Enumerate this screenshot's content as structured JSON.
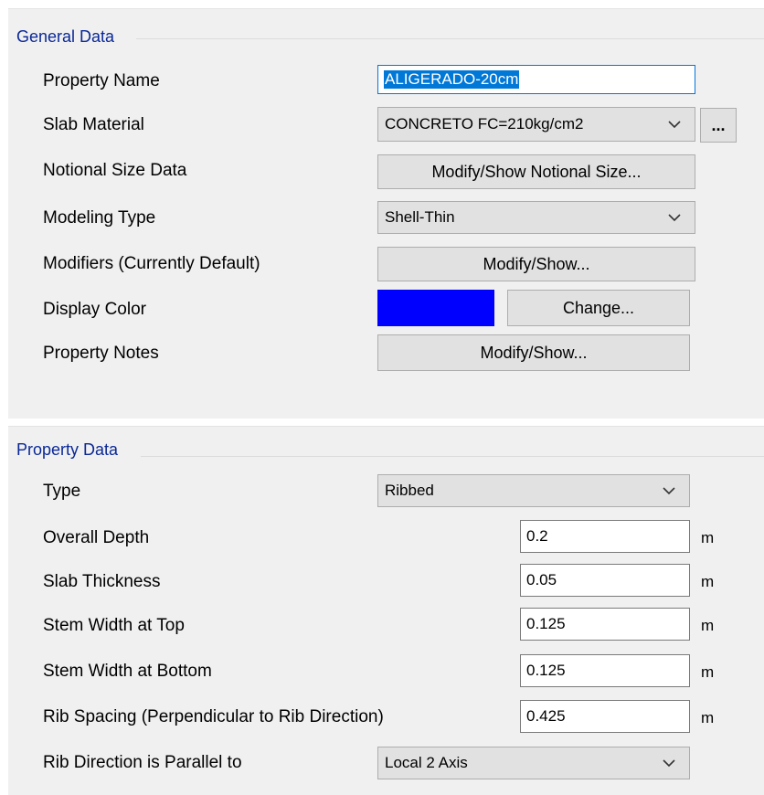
{
  "general": {
    "title": "General Data",
    "property_name_label": "Property Name",
    "property_name_value": "ALIGERADO-20cm",
    "slab_material_label": "Slab Material",
    "slab_material_value": "CONCRETO FC=210kg/cm2",
    "ellipsis_label": "...",
    "notional_label": "Notional Size Data",
    "notional_button": "Modify/Show Notional Size...",
    "modeling_type_label": "Modeling Type",
    "modeling_type_value": "Shell-Thin",
    "modifiers_label": "Modifiers (Currently Default)",
    "modifiers_button": "Modify/Show...",
    "display_color_label": "Display Color",
    "display_color_value": "#0000ff",
    "change_button": "Change...",
    "property_notes_label": "Property Notes",
    "property_notes_button": "Modify/Show..."
  },
  "property": {
    "title": "Property Data",
    "type_label": "Type",
    "type_value": "Ribbed",
    "overall_depth_label": "Overall Depth",
    "overall_depth_value": "0.2",
    "slab_thickness_label": "Slab Thickness",
    "slab_thickness_value": "0.05",
    "stem_top_label": "Stem Width at Top",
    "stem_top_value": "0.125",
    "stem_bottom_label": "Stem Width at Bottom",
    "stem_bottom_value": "0.125",
    "rib_spacing_label": "Rib Spacing (Perpendicular to Rib Direction)",
    "rib_spacing_value": "0.425",
    "rib_direction_label": "Rib Direction is Parallel to",
    "rib_direction_value": "Local 2 Axis",
    "unit": "m"
  },
  "icons": {
    "dropdown": "chevron-down-icon"
  },
  "colors": {
    "focus": "#0078d7",
    "group_title": "#0a2896"
  }
}
